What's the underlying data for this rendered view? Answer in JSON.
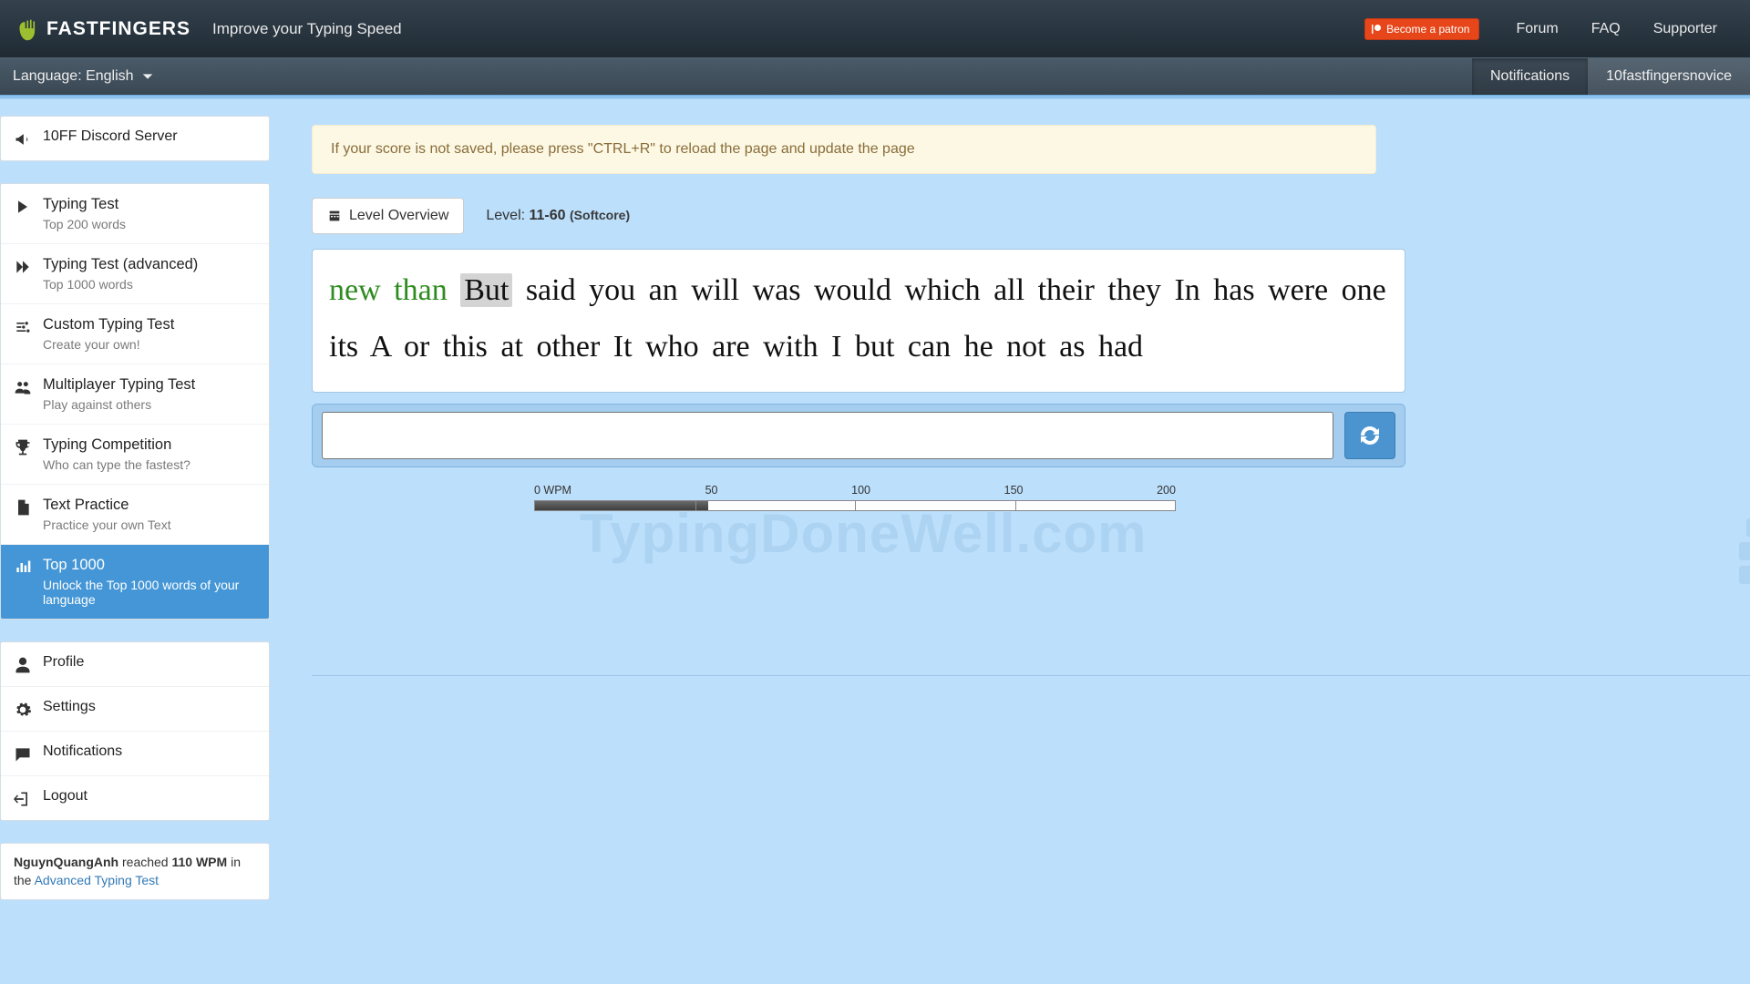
{
  "top": {
    "brand_bold": "FAST",
    "brand_rest": "FINGERS",
    "tagline": "Improve your Typing Speed",
    "patreon": "Become a patron",
    "links": {
      "forum": "Forum",
      "faq": "FAQ",
      "supporter": "Supporter"
    }
  },
  "subnav": {
    "language_label": "Language: English",
    "notifications": "Notifications",
    "username": "10fastfingersnovice"
  },
  "sidebar": {
    "discord": "10FF Discord Server",
    "items": [
      {
        "title": "Typing Test",
        "sub": "Top 200 words",
        "icon": "play"
      },
      {
        "title": "Typing Test (advanced)",
        "sub": "Top 1000 words",
        "icon": "forward"
      },
      {
        "title": "Custom Typing Test",
        "sub": "Create your own!",
        "icon": "sliders"
      },
      {
        "title": "Multiplayer Typing Test",
        "sub": "Play against others",
        "icon": "users"
      },
      {
        "title": "Typing Competition",
        "sub": "Who can type the fastest?",
        "icon": "trophy"
      },
      {
        "title": "Text Practice",
        "sub": "Practice your own Text",
        "icon": "doc"
      },
      {
        "title": "Top 1000",
        "sub": "Unlock the Top 1000 words of your language",
        "icon": "bars",
        "active": true
      }
    ],
    "account": {
      "profile": "Profile",
      "settings": "Settings",
      "notifications": "Notifications",
      "logout": "Logout"
    },
    "feed": {
      "user": "NguynQuangAnh",
      "mid": " reached ",
      "wpm": "110 WPM",
      "tail_prefix": " in the ",
      "tail_link": "Advanced Typing Test"
    }
  },
  "main": {
    "alert": "If your score is not saved, please press \"CTRL+R\" to reload the page and update the page",
    "level_overview_btn": "Level Overview",
    "level_label": "Level: ",
    "level_value": "11-60",
    "level_mode": "(Softcore)",
    "words_correct": [
      "new",
      "than"
    ],
    "words_current": "But",
    "words_rest": [
      "said",
      "you",
      "an",
      "will",
      "was",
      "would",
      "which",
      "all",
      "their",
      "they",
      "In",
      "has",
      "were",
      "one",
      "its",
      "A",
      "or",
      "this",
      "at",
      "other",
      "It",
      "who",
      "are",
      "with",
      "I",
      "but",
      "can",
      "he",
      "not",
      "as",
      "had"
    ],
    "input_value": "",
    "scale": {
      "ticks": [
        "0 WPM",
        "50",
        "100",
        "150",
        "200"
      ],
      "fill_percent": 27
    }
  },
  "watermark": "TypingDoneWell.com"
}
